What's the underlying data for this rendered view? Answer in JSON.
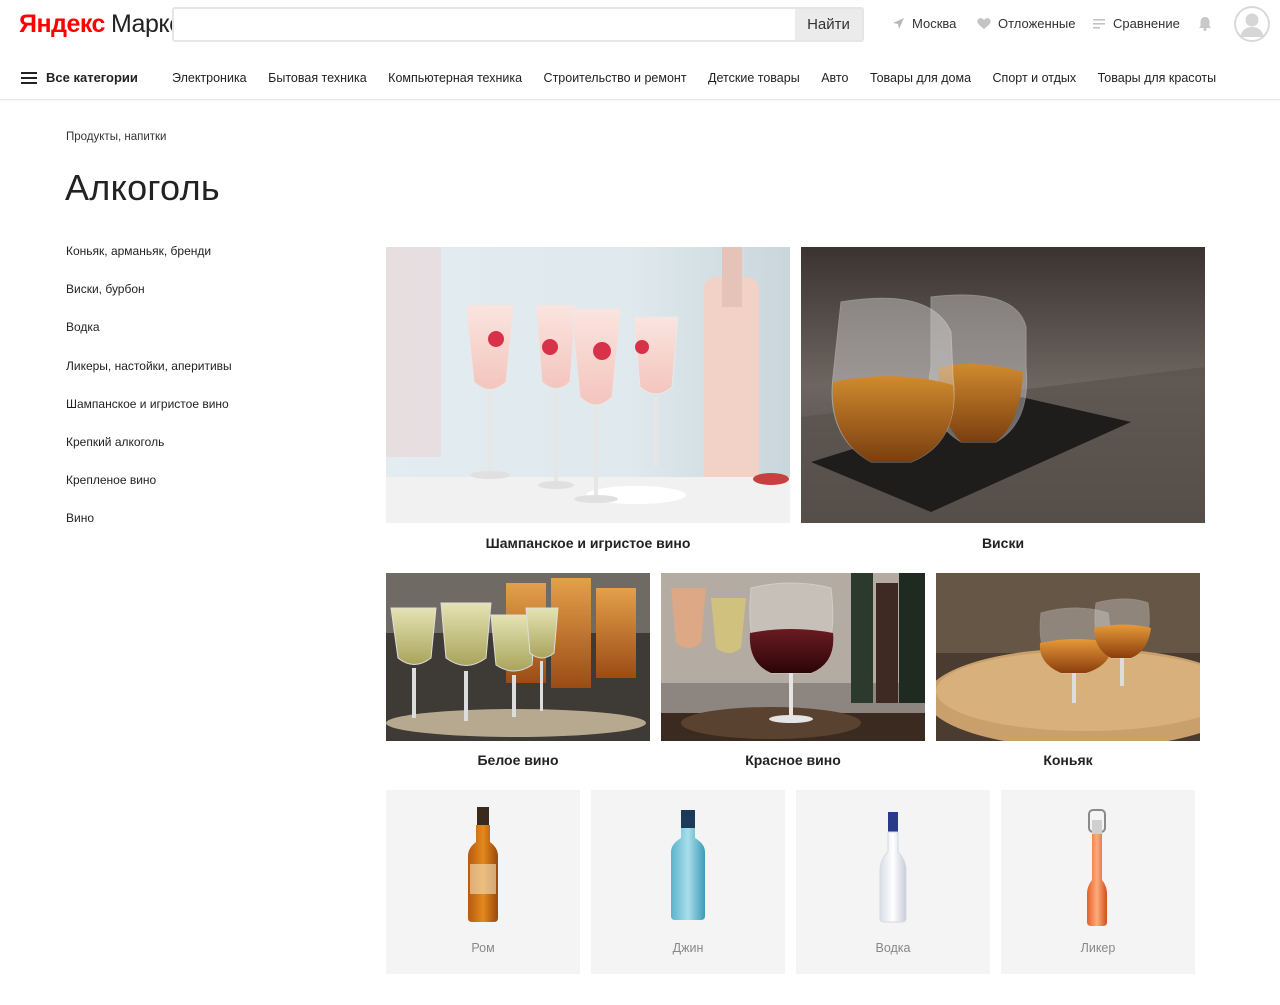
{
  "header": {
    "logo_brand": "Яндекс",
    "logo_product": "Маркет",
    "search_placeholder": "",
    "search_button": "Найти",
    "location": "Москва",
    "favorites": "Отложенные",
    "compare": "Сравнение"
  },
  "nav": {
    "all_categories": "Все категории",
    "links": [
      "Электроника",
      "Бытовая техника",
      "Компьютерная техника",
      "Строительство и ремонт",
      "Детские товары",
      "Авто",
      "Товары для дома",
      "Спорт и отдых",
      "Товары для красоты"
    ]
  },
  "page": {
    "breadcrumb": "Продукты, напитки",
    "title": "Алкоголь"
  },
  "sidebar": {
    "items": [
      "Коньяк, арманьяк, бренди",
      "Виски, бурбон",
      "Водка",
      "Ликеры, настойки, аперитивы",
      "Шампанское и игристое вино",
      "Крепкий алкоголь",
      "Крепленое вино",
      "Вино"
    ]
  },
  "tiles": {
    "big": [
      "Шампанское и игристое вино",
      "Виски"
    ],
    "medium": [
      "Белое вино",
      "Красное вино",
      "Коньяк"
    ]
  },
  "products": [
    "Ром",
    "Джин",
    "Водка",
    "Ликер"
  ],
  "colors": {
    "brand_red": "#ff0000",
    "muted_label": "#888888",
    "tile_bg": "#f4f4f4"
  },
  "icons": {
    "location": "arrow-location-icon",
    "favorites": "heart-icon",
    "compare": "compare-list-icon",
    "notifications": "bell-icon",
    "profile": "avatar-icon",
    "menu": "burger-icon"
  }
}
